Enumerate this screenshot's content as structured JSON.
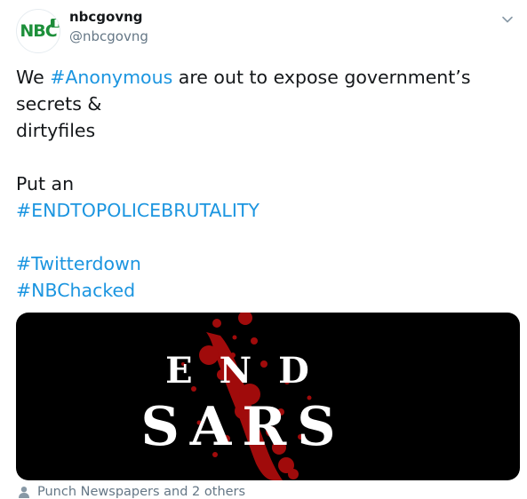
{
  "colors": {
    "brand": "#1d8f3a",
    "link": "#1b95e0",
    "blood": "#a00b0b"
  },
  "tweet": {
    "display_name": "nbcgovng",
    "handle": "@nbcgovng",
    "avatar_text": "NBC",
    "menu_icon": "chevron-down-icon",
    "lines": {
      "l1_pre": "We ",
      "l1_tag": "#Anonymous",
      "l1_post": " are out to expose government’s",
      "l2": "secrets &",
      "l3": "dirtyfiles",
      "l4": "Put an",
      "l5_tag": "#ENDTOPOLICEBRUTALITY",
      "l6_tag": "#Twitterdown",
      "l7_tag": "#NBChacked"
    },
    "media": {
      "line1": "END",
      "line2": "SARS"
    },
    "tagged": {
      "icon": "person-icon",
      "text": "Punch Newspapers and 2 others"
    }
  }
}
